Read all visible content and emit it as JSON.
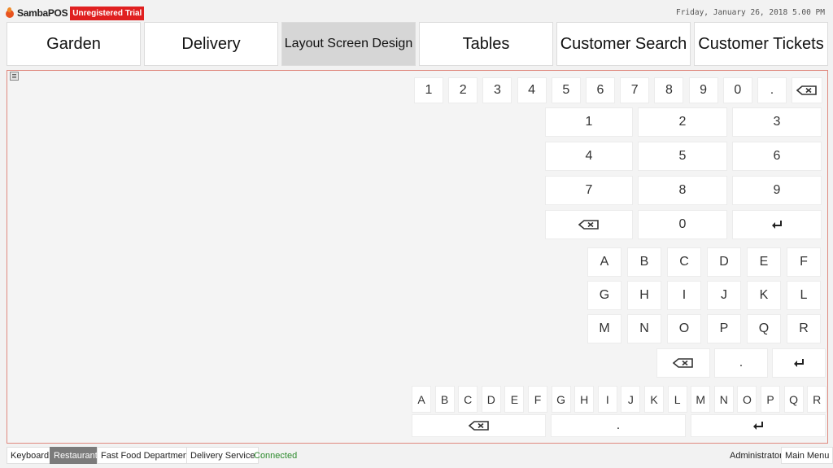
{
  "header": {
    "app_name": "SambaPOS",
    "trial_badge": "Unregistered Trial",
    "datetime": "Friday, January 26, 2018 5.00 PM"
  },
  "tabs": [
    {
      "label": "Garden"
    },
    {
      "label": "Delivery"
    },
    {
      "label": "Layout Screen Design"
    },
    {
      "label": "Tables"
    },
    {
      "label": "Customer Search"
    },
    {
      "label": "Customer Tickets"
    }
  ],
  "keyboard": {
    "number_row": [
      "1",
      "2",
      "3",
      "4",
      "5",
      "6",
      "7",
      "8",
      "9",
      "0",
      "."
    ],
    "numpad": [
      "1",
      "2",
      "3",
      "4",
      "5",
      "6",
      "7",
      "8",
      "9",
      "0"
    ],
    "alpha_grid": [
      "A",
      "B",
      "C",
      "D",
      "E",
      "F",
      "G",
      "H",
      "I",
      "J",
      "K",
      "L",
      "M",
      "N",
      "O",
      "P",
      "Q",
      "R"
    ],
    "alpha_dot": ".",
    "alpha_row": [
      "A",
      "B",
      "C",
      "D",
      "E",
      "F",
      "G",
      "H",
      "I",
      "J",
      "K",
      "L",
      "M",
      "N",
      "O",
      "P",
      "Q",
      "R"
    ],
    "bottom_dot": "."
  },
  "statusbar": {
    "keyboard": "Keyboard",
    "restaurant": "Restaurant",
    "fastfood": "Fast Food Department",
    "delivery": "Delivery Service",
    "connected": "Connected",
    "admin": "Administrator",
    "main_menu": "Main Menu"
  },
  "colors": {
    "trial_bg": "#e02020",
    "panel_border": "#e08a80",
    "connected": "#2e8b2e",
    "active_tab": "#d6d6d6",
    "active_status": "#7b7b7b"
  },
  "icons": {
    "backspace": "backspace-icon",
    "enter": "enter-icon",
    "edit": "edit-layout-icon"
  }
}
